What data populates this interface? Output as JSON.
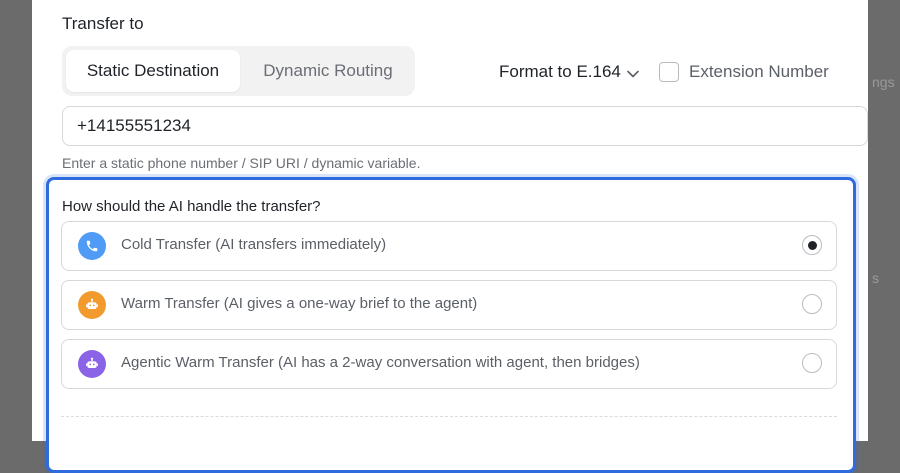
{
  "backdrop": {
    "right_text_1": "ngs",
    "right_text_2": "s"
  },
  "transfer": {
    "title": "Transfer to",
    "tabs": [
      {
        "label": "Static Destination",
        "active": true
      },
      {
        "label": "Dynamic Routing",
        "active": false
      }
    ],
    "format_label": "Format to E.164",
    "extension_label": "Extension Number",
    "extension_checked": false,
    "phone_value": "+14155551234",
    "helper_text": "Enter a static phone number / SIP URI / dynamic variable."
  },
  "handling": {
    "question": "How should the AI handle the transfer?",
    "options": [
      {
        "label": "Cold Transfer (AI transfers immediately)",
        "icon": "phone-icon",
        "color": "#4f9bf5",
        "selected": true
      },
      {
        "label": "Warm Transfer (AI gives a one-way brief to the agent)",
        "icon": "robot-icon",
        "color": "#f39a2e",
        "selected": false
      },
      {
        "label": "Agentic Warm Transfer (AI has a 2-way conversation with agent, then bridges)",
        "icon": "bot-icon",
        "color": "#8a63e6",
        "selected": false
      }
    ]
  }
}
